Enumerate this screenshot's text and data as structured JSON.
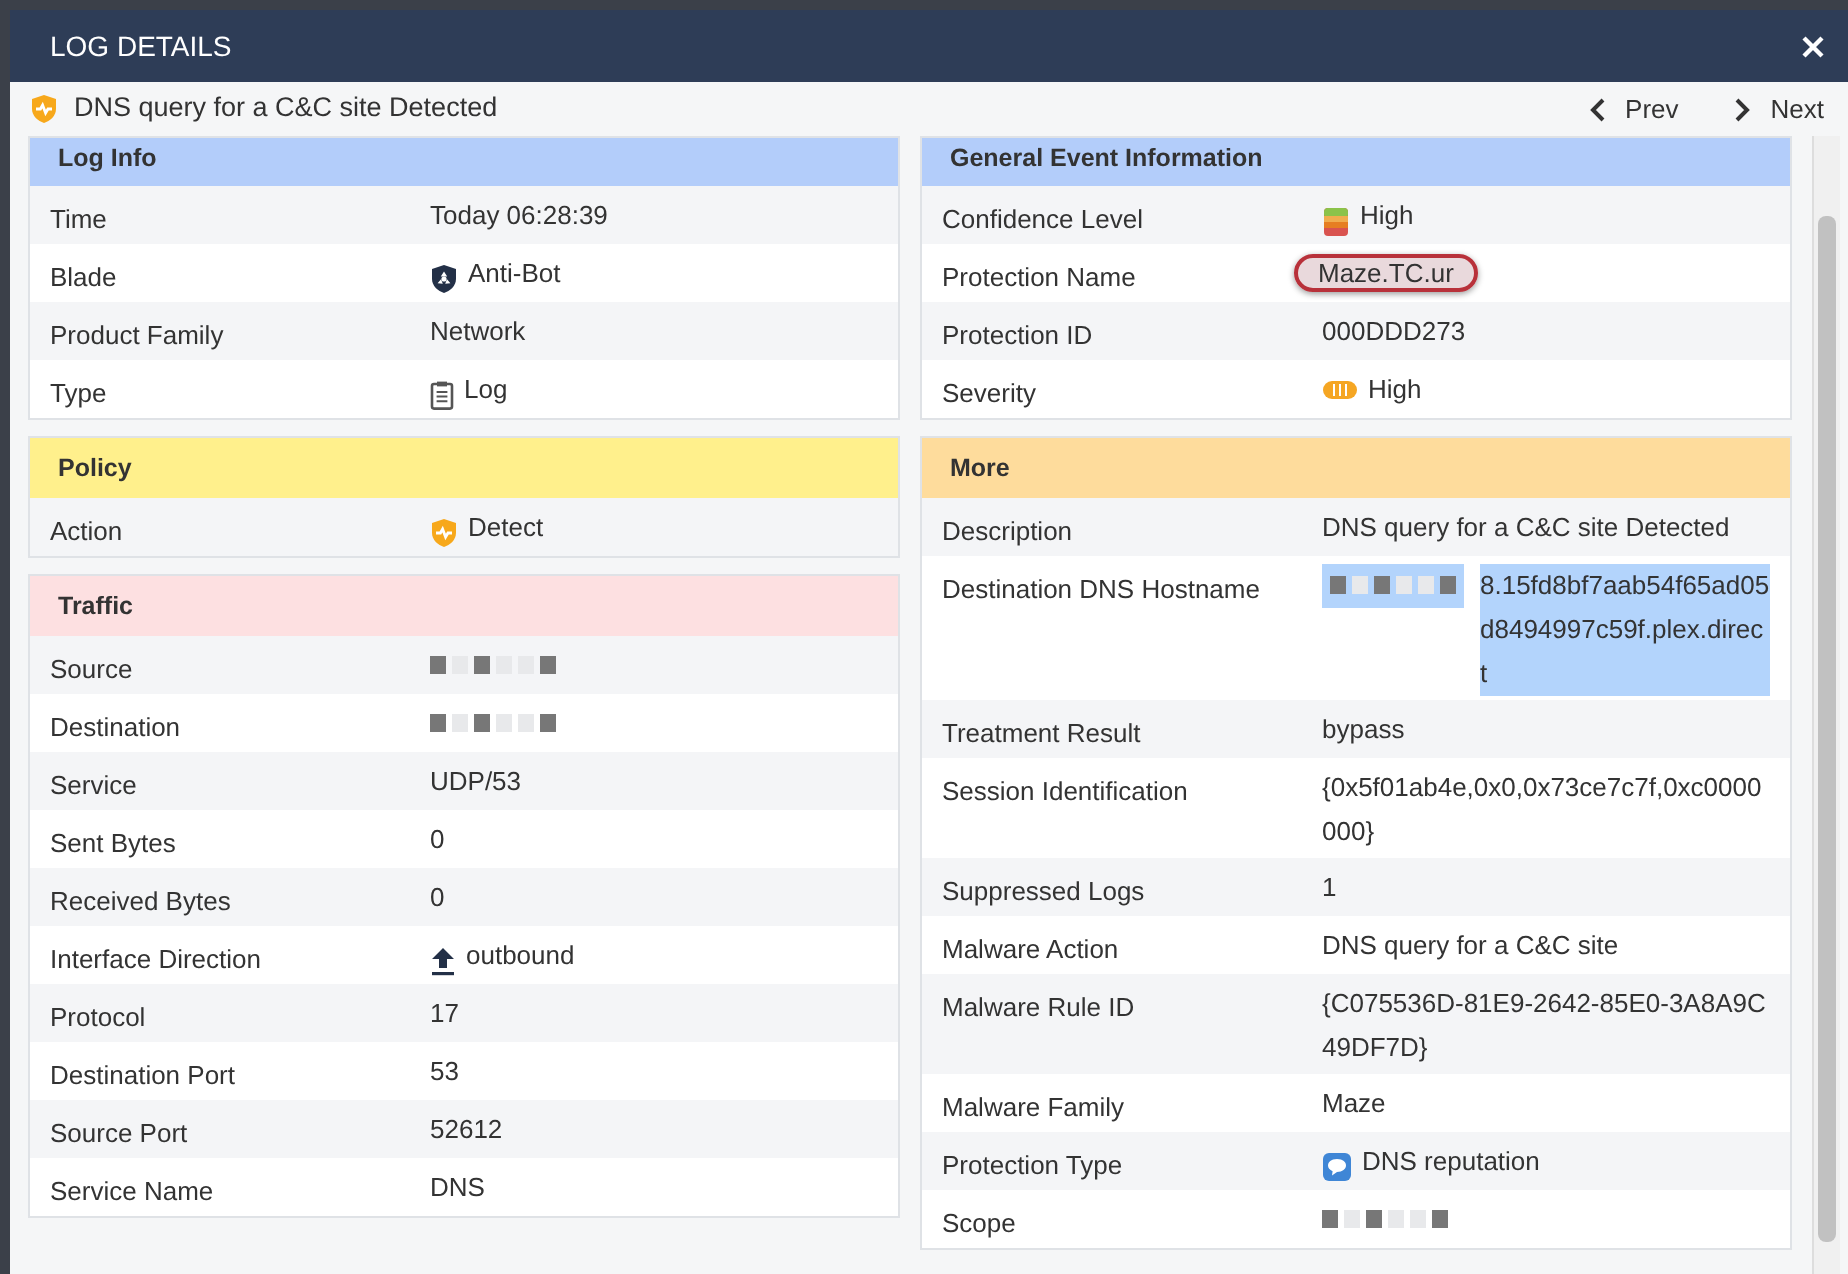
{
  "window": {
    "title": "LOG DETAILS"
  },
  "toolbar": {
    "event": {
      "title": "DNS query for a C&C site Detected",
      "kind": "shield-detect"
    },
    "prev": "Prev",
    "next": "Next"
  },
  "columns": [
    {
      "sections": [
        {
          "title": "Log Info",
          "color": "#b3cdfa",
          "rows": [
            {
              "label": "Time",
              "value": "Today 06:28:39"
            },
            {
              "label": "Blade",
              "value": "Anti-Bot",
              "kind": "antibot"
            },
            {
              "label": "Product Family",
              "value": "Network"
            },
            {
              "label": "Type",
              "value": "Log",
              "kind": "clipboard"
            }
          ]
        },
        {
          "title": "Policy",
          "color": "#fff08c",
          "rows": [
            {
              "label": "Action",
              "value": "Detect",
              "kind": "shield-detect"
            }
          ]
        },
        {
          "title": "Traffic",
          "color": "#fde0e1",
          "rows": [
            {
              "label": "Source",
              "kind": "redacted"
            },
            {
              "label": "Destination",
              "kind": "redacted"
            },
            {
              "label": "Service",
              "value": "UDP/53"
            },
            {
              "label": "Sent Bytes",
              "value": "0"
            },
            {
              "label": "Received Bytes",
              "value": "0"
            },
            {
              "label": "Interface Direction",
              "value": "outbound",
              "kind": "upload"
            },
            {
              "label": "Protocol",
              "value": "17"
            },
            {
              "label": "Destination Port",
              "value": "53"
            },
            {
              "label": "Source Port",
              "value": "52612"
            },
            {
              "label": "Service Name",
              "value": "DNS"
            }
          ]
        }
      ]
    },
    {
      "sections": [
        {
          "title": "General Event Information",
          "color": "#b3cdfa",
          "rows": [
            {
              "label": "Confidence Level",
              "value": "High",
              "kind": "confidence"
            },
            {
              "label": "Protection Name",
              "value": "Maze.TC.ur",
              "circled": true
            },
            {
              "label": "Protection ID",
              "value": "000DDD273"
            },
            {
              "label": "Severity",
              "value": "High",
              "kind": "severity"
            }
          ]
        },
        {
          "title": "More",
          "color": "#fedc9c",
          "rows": [
            {
              "label": "Description",
              "value": "DNS query for a C&C site Detected"
            },
            {
              "label": "Destination DNS Hostname",
              "value": "8.15fd8bf7aab54f65ad05d8494997c59f.plex.direct",
              "kind": "redacted-prefix",
              "highlighted": true
            },
            {
              "label": "Treatment Result",
              "value": "bypass"
            },
            {
              "label": "Session Identification",
              "value": "{0x5f01ab4e,0x0,0x73ce7c7f,0xc0000000}"
            },
            {
              "label": "Suppressed Logs",
              "value": "1"
            },
            {
              "label": "Malware Action",
              "value": "DNS query for a C&C site"
            },
            {
              "label": "Malware Rule ID",
              "value": "{C075536D-81E9-2642-85E0-3A8A9C49DF7D}"
            },
            {
              "label": "Malware Family",
              "value": "Maze"
            },
            {
              "label": "Protection Type",
              "value": "DNS reputation",
              "kind": "bubble"
            },
            {
              "label": "Scope",
              "kind": "redacted"
            }
          ]
        }
      ]
    }
  ]
}
